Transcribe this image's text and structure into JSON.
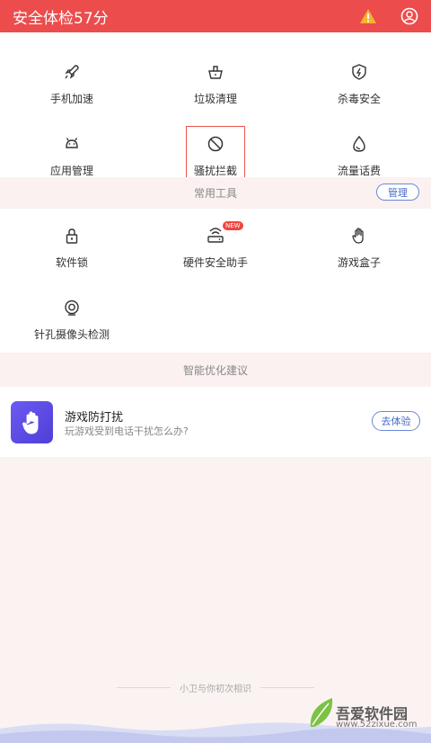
{
  "header": {
    "title": "安全体检57分",
    "warn_icon": "warning-icon",
    "user_icon": "user-icon"
  },
  "features": [
    {
      "label": "手机加速",
      "icon": "rocket-icon"
    },
    {
      "label": "垃圾清理",
      "icon": "trash-icon"
    },
    {
      "label": "杀毒安全",
      "icon": "shield-icon"
    },
    {
      "label": "应用管理",
      "icon": "android-icon"
    },
    {
      "label": "骚扰拦截",
      "icon": "block-icon"
    },
    {
      "label": "流量话费",
      "icon": "drop-icon"
    }
  ],
  "tools_section": {
    "title": "常用工具",
    "manage_label": "管理"
  },
  "tools": [
    {
      "label": "软件锁",
      "icon": "lock-icon"
    },
    {
      "label": "硬件安全助手",
      "icon": "router-icon",
      "badge": "NEW"
    },
    {
      "label": "游戏盒子",
      "icon": "hand-icon"
    },
    {
      "label": "针孔摄像头检测",
      "icon": "camera-icon"
    }
  ],
  "suggest_section": {
    "title": "智能优化建议"
  },
  "suggestion": {
    "title": "游戏防打扰",
    "subtitle": "玩游戏受到电话干扰怎么办?",
    "button": "去体验"
  },
  "footer": {
    "text": "小卫与你初次相识"
  },
  "watermark": {
    "text": "吾爱软件园",
    "url": "www.52zixue.com"
  },
  "colors": {
    "header": "#ec4c4c",
    "accent": "#4a6ac8",
    "highlight": "#e8574e"
  }
}
